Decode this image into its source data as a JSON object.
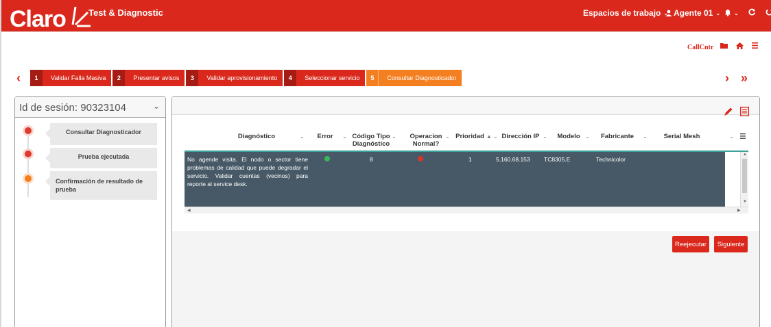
{
  "header": {
    "logo": "Claro",
    "app_title": "Test & Diagnostic",
    "workspaces_label": "Espacios de trabajo",
    "agent_label": "Agente 01"
  },
  "subbar": {
    "callcntr_label": "CallCntr"
  },
  "steps": [
    {
      "num": "1",
      "label": "Validar Falla Masiva"
    },
    {
      "num": "2",
      "label": "Presentar avisos"
    },
    {
      "num": "3",
      "label": "Validar aprovisionamiento"
    },
    {
      "num": "4",
      "label": "Seleccionar servicio"
    },
    {
      "num": "5",
      "label": "Consultar Diagnosticador"
    }
  ],
  "session": {
    "label": "Id de sesión: 90323104"
  },
  "timeline": [
    {
      "label": "Consultar Diagnosticador"
    },
    {
      "label": "Prueba ejecutada"
    },
    {
      "label": "Confirmación de resultado de prueba"
    }
  ],
  "table": {
    "columns": [
      {
        "line1": "Diagnóstico",
        "line2": ""
      },
      {
        "line1": "Error",
        "line2": ""
      },
      {
        "line1": "Código Tipo",
        "line2": "Diagnóstico"
      },
      {
        "line1": "Operacion",
        "line2": "Normal?"
      },
      {
        "line1": "Prioridad",
        "line2": ""
      },
      {
        "line1": "Dirección IP",
        "line2": ""
      },
      {
        "line1": "Modelo",
        "line2": ""
      },
      {
        "line1": "Fabricante",
        "line2": ""
      },
      {
        "line1": "Serial Mesh",
        "line2": ""
      }
    ],
    "row": {
      "diagnostico": "No agende visita. El nodo o sector tiene problemas de calidad que puede degradar el servicio. Validar cuentas (vecinos) para reporte al service desk.",
      "codigo_tipo": "8",
      "prioridad": "1",
      "ip": "5.160.68.153",
      "modelo": "TC8305.E",
      "fabricante": "Technicolor",
      "serial_mesh": ""
    }
  },
  "buttons": {
    "reejecutar": "Reejecutar",
    "siguiente": "Siguiente"
  },
  "colors": {
    "brand": "#da291c",
    "active_step": "#f47f20",
    "row_bg": "#475966",
    "accent_line": "#3da398"
  }
}
